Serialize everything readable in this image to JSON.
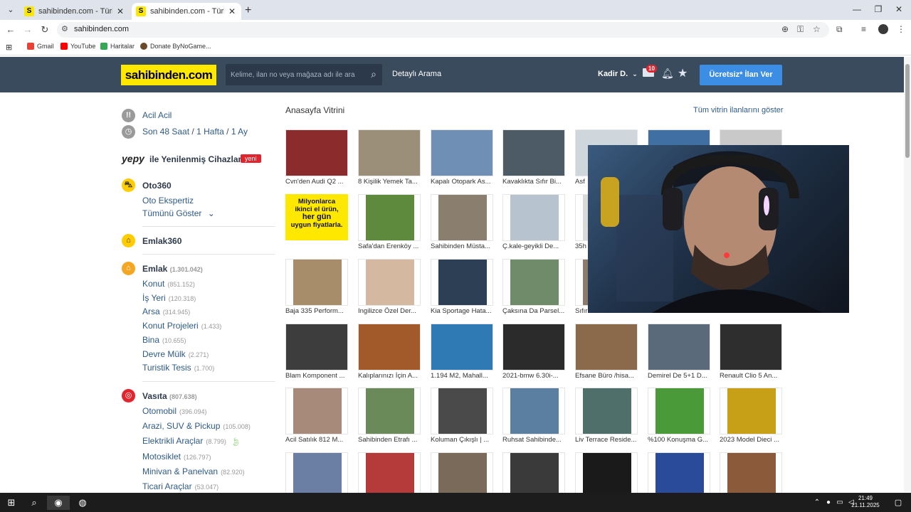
{
  "browser": {
    "tabs": [
      {
        "favicon": "S",
        "title": "sahibinden.com - Türkiye'nin O"
      },
      {
        "favicon": "S",
        "title": "sahibinden.com - Türkiye'nin O"
      }
    ],
    "url": "sahibinden.com",
    "bookmarks": [
      "Gmail",
      "YouTube",
      "Haritalar",
      "Donate ByNoGame..."
    ]
  },
  "header": {
    "logo": "sahibinden.com",
    "search_placeholder": "Kelime, ilan no veya mağaza adı ile ara",
    "advanced_search": "Detaylı Arama",
    "user_name": "Kadir D.",
    "message_count": "10",
    "post_button": "Ücretsiz* İlan Ver"
  },
  "sidebar": {
    "urgent": "Acil Acil",
    "recent": {
      "a": "Son 48 Saat",
      "b": "1 Hafta",
      "c": "1 Ay",
      "sep": "/"
    },
    "yepy": {
      "logo": "yepy",
      "text": "ile Yenilenmiş Cihazlar",
      "badge": "yeni"
    },
    "oto360": {
      "title": "Oto360",
      "items": [
        "Oto Ekspertiz",
        "Tümünü Göster"
      ]
    },
    "emlak360": {
      "title": "Emlak360"
    },
    "emlak": {
      "title": "Emlak",
      "count": "(1.301.042)",
      "items": [
        {
          "label": "Konut",
          "count": "(851.152)"
        },
        {
          "label": "İş Yeri",
          "count": "(120.318)"
        },
        {
          "label": "Arsa",
          "count": "(314.945)"
        },
        {
          "label": "Konut Projeleri",
          "count": "(1.433)"
        },
        {
          "label": "Bina",
          "count": "(10.655)"
        },
        {
          "label": "Devre Mülk",
          "count": "(2.271)"
        },
        {
          "label": "Turistik Tesis",
          "count": "(1.700)"
        }
      ]
    },
    "vasita": {
      "title": "Vasıta",
      "count": "(807.638)",
      "items": [
        {
          "label": "Otomobil",
          "count": "(396.094)"
        },
        {
          "label": "Arazi, SUV & Pickup",
          "count": "(105.008)"
        },
        {
          "label": "Elektrikli Araçlar",
          "count": "(8.799)"
        },
        {
          "label": "Motosiklet",
          "count": "(126.797)"
        },
        {
          "label": "Minivan & Panelvan",
          "count": "(82.920)"
        },
        {
          "label": "Ticari Araçlar",
          "count": "(53.047)"
        }
      ]
    }
  },
  "showcase": {
    "title": "Anasayfa Vitrini",
    "show_all": "Tüm vitrin ilanlarını göster",
    "promo": {
      "l1": "Milyonlarca",
      "l2": "ikinci el ürün,",
      "l3": "her gün",
      "l4": "uygun fiyatlarla."
    },
    "rows": [
      [
        "Cvn'den Audi Q2 ...",
        "8 Kişilik Yemek Ta...",
        "Kapalı Otopark As...",
        "Kavaklıkta Sıfır Bi...",
        "Asf",
        "",
        ""
      ],
      [
        "",
        "Safa'dan Erenköy ...",
        "Sahibinden Müsta...",
        "Ç.kale-geyikli De...",
        "35h",
        "",
        ""
      ],
      [
        "Baja 335 Perform...",
        "Ingilizce Özel Der...",
        "Kia Sportage Hata...",
        "Çaksına Da Parsel...",
        "Sıfır",
        "",
        ""
      ],
      [
        "Blam Komponent ...",
        "Kalıplarınızı İçin A...",
        "1.194 M2, Mahall...",
        "2021-bmw 6.30i-...",
        "Efsane Büro /hisa...",
        "Demirel De 5+1 D...",
        "Renault Clio 5 An..."
      ],
      [
        "Acil Satılık 812 M...",
        "Sahibinden Etrafı ...",
        "Koluman Çıkışlı | ...",
        "Ruhsat Sahibinde...",
        "Liv Terrace Reside...",
        "%100 Konuşma G...",
        "2023 Model Dieci ..."
      ],
      [
        "",
        "",
        "",
        "",
        "",
        "",
        ""
      ]
    ]
  },
  "taskbar": {
    "time": "21:49",
    "date": "21.11.2025"
  }
}
